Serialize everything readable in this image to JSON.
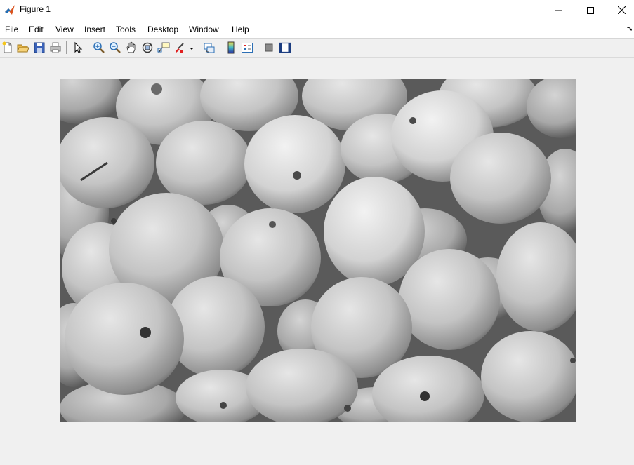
{
  "window": {
    "title": "Figure 1",
    "app_icon": "matlab-logo",
    "controls": [
      "minimize-icon",
      "maximize-icon",
      "close-icon"
    ]
  },
  "menu": {
    "items": [
      "File",
      "Edit",
      "View",
      "Insert",
      "Tools",
      "Desktop",
      "Window",
      "Help"
    ]
  },
  "toolbar": {
    "buttons": [
      "new-figure-icon",
      "open-file-icon",
      "save-icon",
      "print-icon",
      "edit-plot-arrow-icon",
      "zoom-in-icon",
      "zoom-out-icon",
      "pan-hand-icon",
      "rotate-3d-icon",
      "data-cursor-icon",
      "brush-icon",
      "link-plot-icon",
      "insert-colorbar-icon",
      "insert-legend-icon",
      "hide-plot-tools-icon",
      "show-plot-tools-icon"
    ]
  },
  "figure": {
    "image_description": "grayscale photograph of a pile of pears",
    "colors": {
      "background": "#f0f0f0",
      "toolbar_icon_blue": "#2c6fb5"
    }
  }
}
